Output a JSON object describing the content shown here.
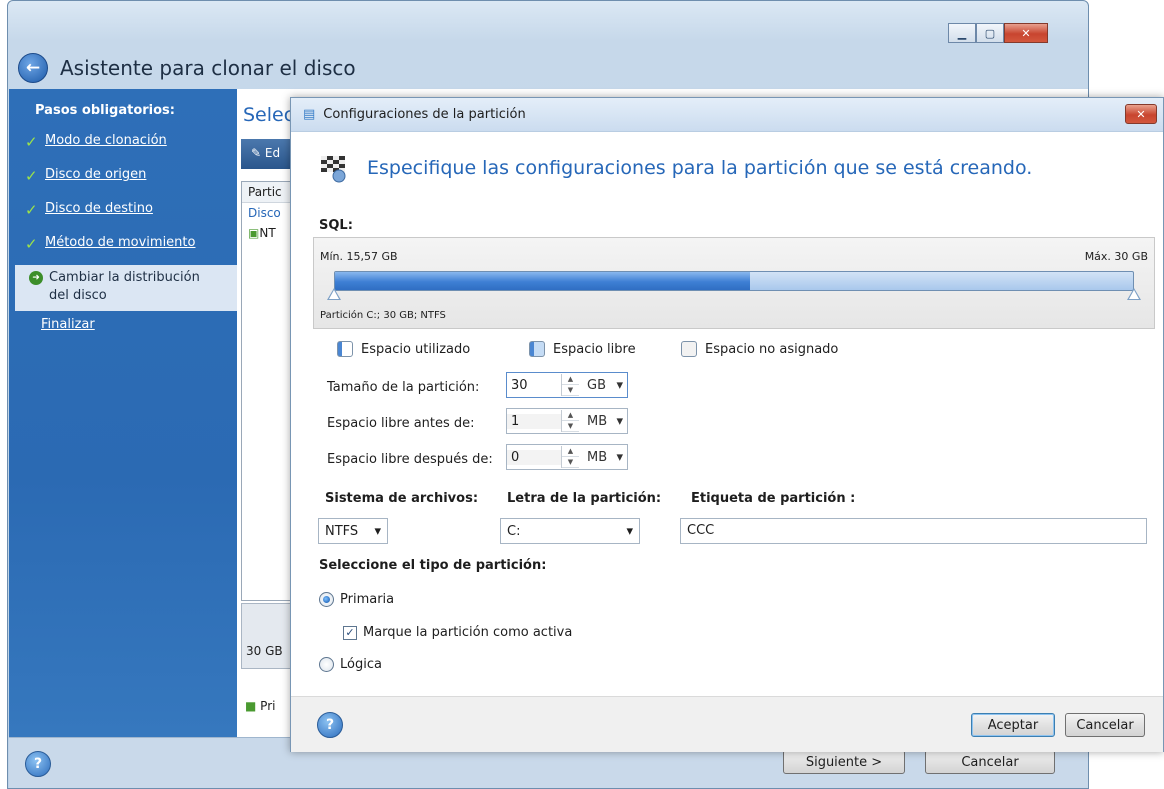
{
  "bg": {
    "title": "Asistente para clonar el disco",
    "sidebar_header": "Pasos obligatorios:",
    "steps": [
      {
        "label": "Modo de clonación"
      },
      {
        "label": "Disco de origen"
      },
      {
        "label": "Disco de destino"
      },
      {
        "label": "Método de movimiento"
      },
      {
        "label": "Cambiar la distribución del disco"
      },
      {
        "label": "Finalizar"
      }
    ],
    "content_title": "Selec",
    "toolbar_btn": "Ed",
    "col_head": "Partic",
    "row_disk": "Disco",
    "row_ntfs": "NT",
    "disk_size": "30 GB",
    "legend_pri": "Pri",
    "next": "Siguiente >",
    "cancel": "Cancelar"
  },
  "dlg": {
    "title": "Configuraciones de la partición",
    "heading": "Especifique las configuraciones para la partición que se está creando.",
    "sql": "SQL:",
    "min": "Mín. 15,57 GB",
    "max": "Máx. 30 GB",
    "part_label": "Partición C:; 30 GB; NTFS",
    "used_fraction": 0.52,
    "legend": {
      "used": "Espacio utilizado",
      "free": "Espacio libre",
      "unalloc": "Espacio no asignado"
    },
    "size_label": "Tamaño de la partición:",
    "size_val": "30",
    "size_unit": "GB",
    "before_label": "Espacio libre antes de:",
    "before_val": "1",
    "before_unit": "MB",
    "after_label": "Espacio libre después de:",
    "after_val": "0",
    "after_unit": "MB",
    "fs_head": "Sistema de archivos:",
    "letter_head": "Letra de la partición:",
    "label_head": "Etiqueta de partición :",
    "fs_val": "NTFS",
    "letter_val": "C:",
    "label_val": "CCC",
    "type_head": "Seleccione el tipo de partición:",
    "primary": "Primaria",
    "active": "Marque la partición como activa",
    "logical": "Lógica",
    "accept": "Aceptar",
    "cancel": "Cancelar"
  }
}
